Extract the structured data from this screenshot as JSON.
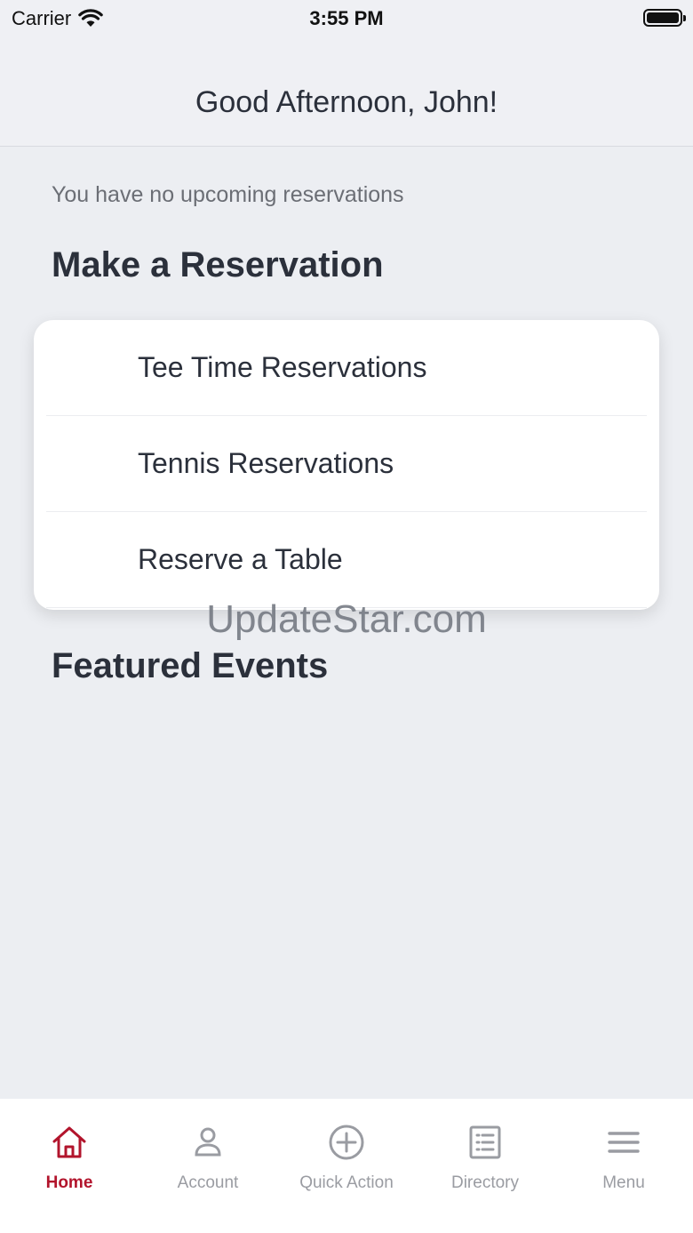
{
  "status_bar": {
    "carrier": "Carrier",
    "time": "3:55 PM"
  },
  "header": {
    "title": "Good Afternoon, John!"
  },
  "main": {
    "no_reservations": "You have no upcoming reservations",
    "make_reservation_title": "Make a Reservation",
    "reservation_options": [
      "Tee Time Reservations",
      "Tennis Reservations",
      "Reserve a Table"
    ],
    "featured_events_title": "Featured Events"
  },
  "watermark": "UpdateStar.com",
  "tabbar": {
    "active_color": "#b2142c",
    "inactive_color": "#9a9ca2",
    "tabs": [
      {
        "label": "Home",
        "icon": "home-icon"
      },
      {
        "label": "Account",
        "icon": "person-icon"
      },
      {
        "label": "Quick Action",
        "icon": "plus-circle-icon"
      },
      {
        "label": "Directory",
        "icon": "list-icon"
      },
      {
        "label": "Menu",
        "icon": "hamburger-icon"
      }
    ]
  }
}
